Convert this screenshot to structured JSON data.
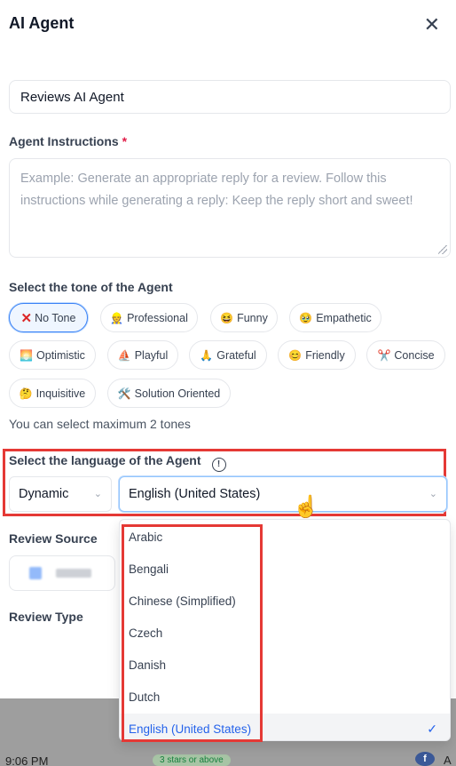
{
  "modal": {
    "title": "AI Agent",
    "close_icon": "close-icon"
  },
  "agent_name": {
    "value": "Reviews AI Agent"
  },
  "instructions": {
    "label": "Agent Instructions",
    "required_mark": "*",
    "placeholder": "Example: Generate an appropriate reply for a review. Follow this instructions while generating a reply: Keep the reply short and sweet!"
  },
  "tone": {
    "label": "Select the tone of the Agent",
    "options": [
      {
        "label": "No Tone",
        "emoji": "❌",
        "selected": true
      },
      {
        "label": "Professional",
        "emoji": "👷",
        "selected": false
      },
      {
        "label": "Funny",
        "emoji": "😆",
        "selected": false
      },
      {
        "label": "Empathetic",
        "emoji": "🥹",
        "selected": false
      },
      {
        "label": "Optimistic",
        "emoji": "🌅",
        "selected": false
      },
      {
        "label": "Playful",
        "emoji": "⛵",
        "selected": false
      },
      {
        "label": "Grateful",
        "emoji": "🙏",
        "selected": false
      },
      {
        "label": "Friendly",
        "emoji": "😊",
        "selected": false
      },
      {
        "label": "Concise",
        "emoji": "✂️",
        "selected": false
      },
      {
        "label": "Inquisitive",
        "emoji": "🤔",
        "selected": false
      },
      {
        "label": "Solution Oriented",
        "emoji": "🛠️",
        "selected": false
      }
    ],
    "hint": "You can select maximum 2 tones"
  },
  "language": {
    "label": "Select the language of the Agent",
    "info_icon_glyph": "!",
    "mode_value": "Dynamic",
    "selected_value": "English (United States)",
    "options": [
      {
        "label": "Arabic"
      },
      {
        "label": "Bengali"
      },
      {
        "label": "Chinese (Simplified)"
      },
      {
        "label": "Czech"
      },
      {
        "label": "Danish"
      },
      {
        "label": "Dutch"
      },
      {
        "label": "English (United States)",
        "selected": true
      }
    ],
    "check_glyph": "✓"
  },
  "review_source": {
    "label": "Review Source"
  },
  "review_type": {
    "label": "Review Type"
  },
  "background": {
    "time": "9:06 PM",
    "badge": "3 stars or above",
    "icon_letter": "f",
    "trailing_char": "A"
  },
  "colors": {
    "highlight_red": "#e53935",
    "accent_blue": "#2563eb",
    "selected_chip_bg": "#eff6ff"
  }
}
